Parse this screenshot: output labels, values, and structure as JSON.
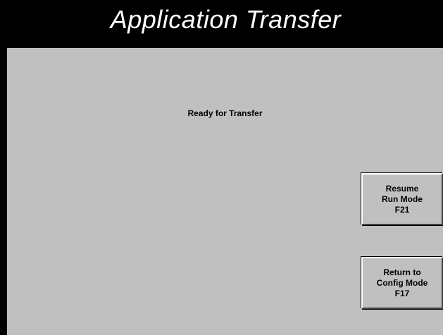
{
  "header": {
    "title": "Application Transfer"
  },
  "main": {
    "status": "Ready for Transfer"
  },
  "buttons": {
    "resume": {
      "line1": "Resume",
      "line2": "Run Mode",
      "key": "F21"
    },
    "config": {
      "line1": "Return to",
      "line2": "Config Mode",
      "key": "F17"
    }
  },
  "colors": {
    "background": "#000000",
    "panel": "#c0c0c0",
    "title_text": "#ffffff",
    "text": "#000000"
  }
}
